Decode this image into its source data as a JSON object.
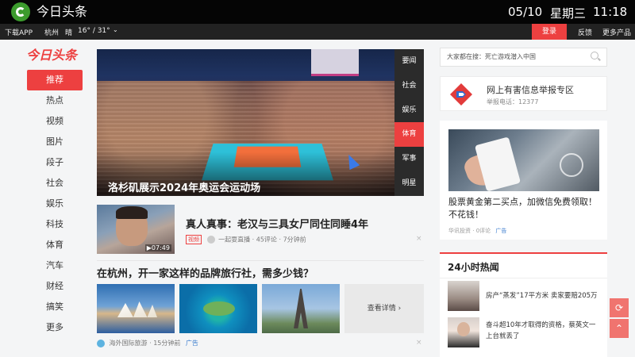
{
  "os_bar": {
    "app_title": "今日头条",
    "date": "05/10",
    "weekday": "星期三",
    "time": "11:18"
  },
  "top_bar": {
    "download": "下载APP",
    "city": "杭州",
    "weather": "晴",
    "temp": "16° / 31°",
    "chevron": "⌄",
    "login": "登录",
    "feedback": "反馈",
    "more": "更多产品"
  },
  "logo": "今日头条",
  "nav": {
    "items": [
      "推荐",
      "热点",
      "视频",
      "图片",
      "段子",
      "社会",
      "娱乐",
      "科技",
      "体育",
      "汽车",
      "财经",
      "搞笑",
      "更多"
    ],
    "active_index": 0
  },
  "hero": {
    "caption": "洛杉矶展示2024年奥运会运动场",
    "tabs": [
      "要闻",
      "社会",
      "娱乐",
      "体育",
      "军事",
      "明星"
    ],
    "active_tab_index": 3
  },
  "article1": {
    "title": "真人真事：老汉与三具女尸同住同睡4年",
    "tag": "视频",
    "source": "一起耍直播",
    "comments": "45评论",
    "time": "7分钟前",
    "duration": "▶07:49",
    "dismiss": "×"
  },
  "article2": {
    "title": "在杭州，开一家这样的品牌旅行社，需多少钱？",
    "view_more": "查看详情 ›",
    "source": "海外国际旅游",
    "time": "15分钟前",
    "ad": "广告",
    "dismiss": "×"
  },
  "right": {
    "search_text": "大家都在搜：死亡游戏潜入中国",
    "report_title": "网上有害信息举报专区",
    "report_phone": "举报电话：12377",
    "ad_title": "股票黄金第二买点，加微信免费领取！不花钱！",
    "ad_source": "华讯投资",
    "ad_comments": "0评论",
    "ad_tag": "广告",
    "hot_title": "24小时热闻",
    "hot_items": [
      "房产“蒸发”17平方米 卖家要赔205万",
      "奋斗超10年才取得的资格，蔡英文一上台就丢了"
    ]
  },
  "fab": {
    "refresh": "⟳",
    "top": "⌃"
  },
  "colors": {
    "accent": "#ed4040",
    "dark_bar": "#222222",
    "link_blue": "#3d7ecf"
  }
}
